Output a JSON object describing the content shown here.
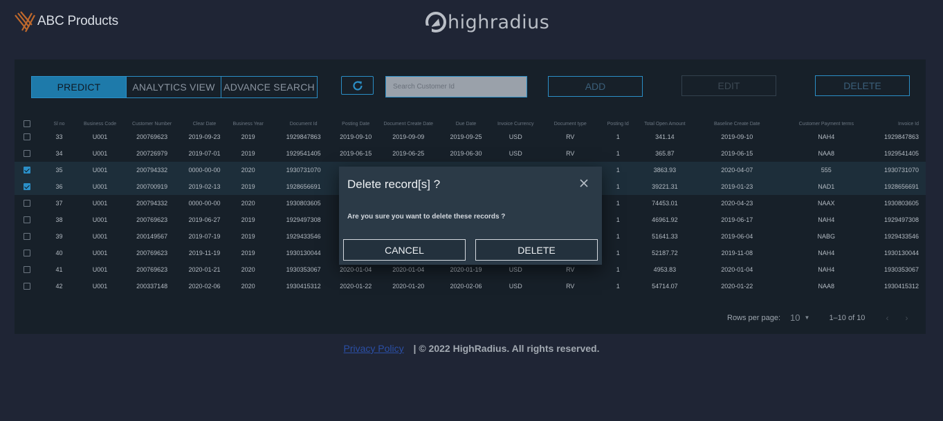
{
  "brand": {
    "name": "ABC Products",
    "logo_icon": "abc-logo-icon"
  },
  "partner": {
    "name": "highradius",
    "logo_icon": "highradius-logo-icon"
  },
  "toolbar": {
    "tabs": [
      {
        "label": "PREDICT",
        "active": true
      },
      {
        "label": "ANALYTICS VIEW",
        "active": false
      },
      {
        "label": "ADVANCE SEARCH",
        "active": false
      }
    ],
    "refresh_icon": "refresh-icon",
    "search_placeholder": "Search Customer Id",
    "add_label": "ADD",
    "edit_label": "EDIT",
    "delete_label": "DELETE"
  },
  "table": {
    "columns": [
      "Sl no",
      "Business Code",
      "Customer Number",
      "Clear Date",
      "Business Year",
      "Document Id",
      "Posting Date",
      "Document Create Date",
      "Due Date",
      "Invoice Currency",
      "Document type",
      "Posting Id",
      "Total Open Amount",
      "Baseline Create Date",
      "Customer Payment terms",
      "Invoice Id"
    ],
    "rows": [
      {
        "checked": false,
        "cells": [
          "33",
          "U001",
          "200769623",
          "2019-09-23",
          "2019",
          "1929847863",
          "2019-09-10",
          "2019-09-09",
          "2019-09-25",
          "USD",
          "RV",
          "1",
          "341.14",
          "2019-09-10",
          "NAH4",
          "1929847863"
        ]
      },
      {
        "checked": false,
        "cells": [
          "34",
          "U001",
          "200726979",
          "2019-07-01",
          "2019",
          "1929541405",
          "2019-06-15",
          "2019-06-25",
          "2019-06-30",
          "USD",
          "RV",
          "1",
          "365.87",
          "2019-06-15",
          "NAA8",
          "1929541405"
        ]
      },
      {
        "checked": true,
        "cells": [
          "35",
          "U001",
          "200794332",
          "0000-00-00",
          "2020",
          "1930731070",
          "",
          "",
          "",
          "",
          "",
          "1",
          "3863.93",
          "2020-04-07",
          "555",
          "1930731070"
        ]
      },
      {
        "checked": true,
        "cells": [
          "36",
          "U001",
          "200700919",
          "2019-02-13",
          "2019",
          "1928656691",
          "",
          "",
          "",
          "",
          "",
          "1",
          "39221.31",
          "2019-01-23",
          "NAD1",
          "1928656691"
        ]
      },
      {
        "checked": false,
        "cells": [
          "37",
          "U001",
          "200794332",
          "0000-00-00",
          "2020",
          "1930803605",
          "",
          "",
          "",
          "",
          "",
          "1",
          "74453.01",
          "2020-04-23",
          "NAAX",
          "1930803605"
        ]
      },
      {
        "checked": false,
        "cells": [
          "38",
          "U001",
          "200769623",
          "2019-06-27",
          "2019",
          "1929497308",
          "",
          "",
          "",
          "",
          "",
          "1",
          "46961.92",
          "2019-06-17",
          "NAH4",
          "1929497308"
        ]
      },
      {
        "checked": false,
        "cells": [
          "39",
          "U001",
          "200149567",
          "2019-07-19",
          "2019",
          "1929433546",
          "",
          "",
          "",
          "",
          "",
          "1",
          "51641.33",
          "2019-06-04",
          "NABG",
          "1929433546"
        ]
      },
      {
        "checked": false,
        "cells": [
          "40",
          "U001",
          "200769623",
          "2019-11-19",
          "2019",
          "1930130044",
          "",
          "",
          "",
          "",
          "",
          "1",
          "52187.72",
          "2019-11-08",
          "NAH4",
          "1930130044"
        ]
      },
      {
        "checked": false,
        "cells": [
          "41",
          "U001",
          "200769623",
          "2020-01-21",
          "2020",
          "1930353067",
          "2020-01-04",
          "2020-01-04",
          "2020-01-19",
          "USD",
          "RV",
          "1",
          "4953.83",
          "2020-01-04",
          "NAH4",
          "1930353067"
        ]
      },
      {
        "checked": false,
        "cells": [
          "42",
          "U001",
          "200337148",
          "2020-02-06",
          "2020",
          "1930415312",
          "2020-01-22",
          "2020-01-20",
          "2020-02-06",
          "USD",
          "RV",
          "1",
          "54714.07",
          "2020-01-22",
          "NAA8",
          "1930415312"
        ]
      }
    ]
  },
  "pagination": {
    "rows_per_page_label": "Rows per page:",
    "rows_per_page_value": "10",
    "range": "1–10 of 10",
    "prev_icon": "chevron-left-icon",
    "next_icon": "chevron-right-icon"
  },
  "footer": {
    "privacy_link": "Privacy Policy",
    "copyright": "| © 2022 HighRadius. All rights reserved."
  },
  "dialog": {
    "title": "Delete record[s] ?",
    "message": "Are you sure you want to delete these records ?",
    "cancel_label": "CANCEL",
    "delete_label": "DELETE",
    "close_icon": "close-icon"
  },
  "colors": {
    "background": "#1f2535",
    "panel": "#172029",
    "accent": "#2b8fc7",
    "dialog": "#2b3a47"
  }
}
